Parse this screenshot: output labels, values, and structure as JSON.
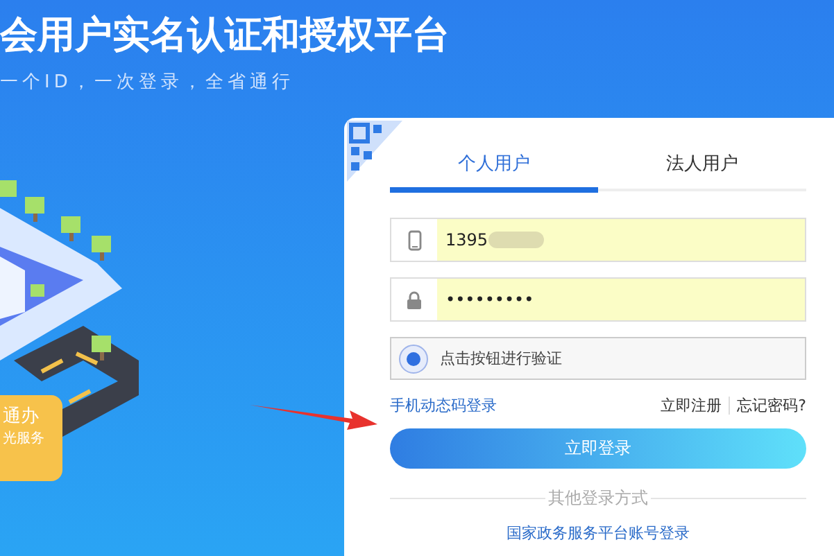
{
  "header": {
    "title": "会用户实名认证和授权平台",
    "subtitle": "一个ID，一次登录，全省通行"
  },
  "illustration": {
    "sign_line_1": "通办",
    "sign_line_2": "光服务"
  },
  "login": {
    "tabs": [
      {
        "label": "个人用户",
        "selected": true
      },
      {
        "label": "法人用户",
        "selected": false
      }
    ],
    "fields": [
      {
        "kind": "phone",
        "value": "1395",
        "blurred": true
      },
      {
        "kind": "password",
        "value": "•••••••••",
        "blurred": false
      }
    ],
    "verify": {
      "label": "点击按钮进行验证"
    },
    "sms_login_link": "手机动态码登录",
    "register_link": "立即注册",
    "forgot_link": "忘记密码?",
    "login_button": "立即登录",
    "other_methods": "其他登录方式",
    "national_login_link": "国家政务服务平台账号登录"
  }
}
